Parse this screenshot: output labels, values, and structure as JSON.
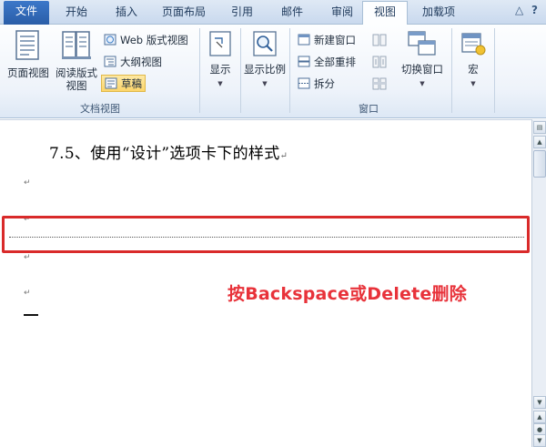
{
  "tabs": [
    "文件",
    "开始",
    "插入",
    "页面布局",
    "引用",
    "邮件",
    "审阅",
    "视图",
    "加载项"
  ],
  "window_controls": [
    "△",
    "?"
  ],
  "ribbon": {
    "doc_view_group": {
      "label": "文档视图",
      "page_view": "页面视图",
      "reading_view_l1": "阅读版式",
      "reading_view_l2": "视图",
      "web_view": "Web 版式视图",
      "outline_view": "大纲视图",
      "draft_view": "草稿"
    },
    "show": {
      "label": "显示"
    },
    "zoom": {
      "label": "显示比例"
    },
    "window_group": {
      "label": "窗口",
      "new_window": "新建窗口",
      "arrange_all": "全部重排",
      "split": "拆分",
      "switch_windows": "切换窗口"
    },
    "macros": {
      "label": "宏"
    }
  },
  "document": {
    "heading": "7.5、使用“设计”选项卡下的样式",
    "heading_mark": "↵",
    "para_mark": "↵",
    "annotation": "按Backspace或Delete删除"
  },
  "colors": {
    "annotation_red": "#e8323a",
    "box_red": "#d92a2a",
    "file_tab_blue": "#2a5ea8"
  }
}
